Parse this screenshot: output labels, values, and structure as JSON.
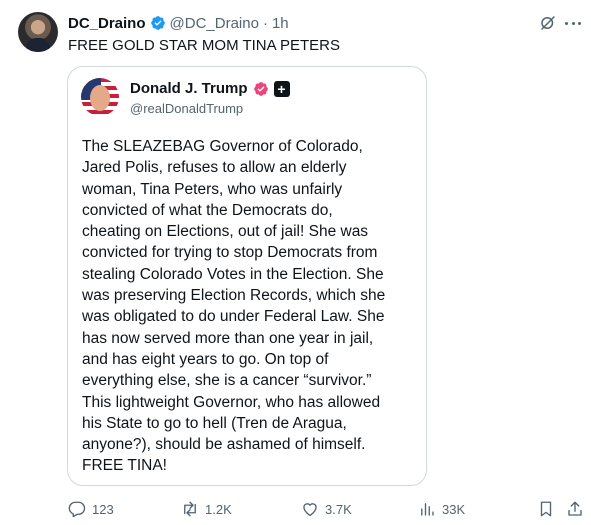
{
  "post": {
    "author": {
      "display_name": "DC_Draino",
      "handle": "@DC_Draino",
      "separator": "·",
      "time": "1h",
      "verified": true
    },
    "text": "FREE GOLD STAR MOM TINA PETERS",
    "icons": {
      "grok": "grok-icon",
      "more": "more-icon"
    }
  },
  "quoted_post": {
    "author": {
      "display_name": "Donald J. Trump",
      "handle": "@realDonaldTrump",
      "badge": "verified-gold-badge",
      "affiliation": "+"
    },
    "text": "The SLEAZEBAG Governor of Colorado,\nJared Polis, refuses to allow an elderly\nwoman, Tina Peters, who was unfairly\nconvicted of what the Democrats do,\ncheating on Elections, out of jail! She was\nconvicted for trying to stop Democrats from\nstealing Colorado Votes in the Election. She\nwas preserving Election Records, which she\nwas obligated to do under Federal Law. She\nhas now served more than one year in jail,\nand has eight years to go. On top of\neverything else, she is a cancer “survivor.”\nThis lightweight Governor, who has allowed\nhis State to go to hell (Tren de Aragua,\nanyone?), should be ashamed of himself.\nFREE TINA!"
  },
  "actions": {
    "reply": {
      "icon": "reply-icon",
      "count": "123"
    },
    "retweet": {
      "icon": "retweet-icon",
      "count": "1.2K"
    },
    "like": {
      "icon": "heart-icon",
      "count": "3.7K"
    },
    "views": {
      "icon": "views-icon",
      "count": "33K"
    },
    "bookmark": {
      "icon": "bookmark-icon"
    },
    "share": {
      "icon": "share-icon"
    }
  },
  "colors": {
    "text": "#0f1419",
    "secondary": "#536471",
    "verified_blue": "#1d9bf0",
    "verified_gold": "#e8467c",
    "border": "#cfd9de"
  }
}
